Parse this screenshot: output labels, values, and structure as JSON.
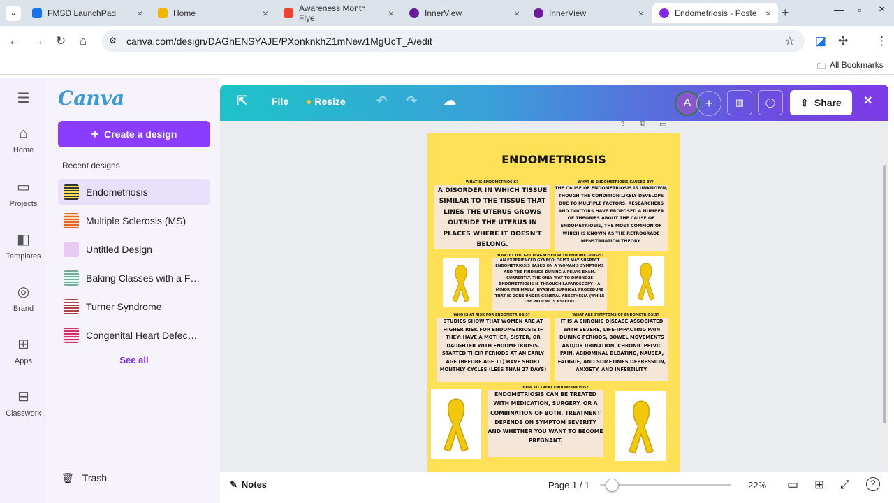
{
  "browser": {
    "tabs": [
      {
        "title": "FMSD LaunchPad",
        "color": "#1a73e8"
      },
      {
        "title": "Home",
        "color": "#f4b400"
      },
      {
        "title": "Awareness Month Flye",
        "color": "#ea4335"
      },
      {
        "title": "InnerView",
        "color": "#6a1b9a"
      },
      {
        "title": "InnerView",
        "color": "#6a1b9a"
      },
      {
        "title": "Endometriosis - Poste",
        "color": "#7d2ae8"
      }
    ],
    "url": "canva.com/design/DAGhENSYAJE/PXonknkhZ1mNew1MgUcT_A/edit",
    "bookmarks_label": "All Bookmarks"
  },
  "rail": [
    {
      "label": "Home",
      "icon": "home-icon",
      "glyph": "⌂"
    },
    {
      "label": "Projects",
      "icon": "folder-icon",
      "glyph": "▭"
    },
    {
      "label": "Templates",
      "icon": "templates-icon",
      "glyph": "◧"
    },
    {
      "label": "Brand",
      "icon": "brand-icon",
      "glyph": "◎"
    },
    {
      "label": "Apps",
      "icon": "apps-icon",
      "glyph": "⊞"
    },
    {
      "label": "Classwork",
      "icon": "classwork-icon",
      "glyph": "⊟"
    }
  ],
  "panel": {
    "logo": "Canva",
    "create": "Create a design",
    "recent_heading": "Recent designs",
    "recent": [
      "Endometriosis",
      "Multiple Sclerosis (MS)",
      "Untitled Design",
      "Baking Classes with a F…",
      "Turner Syndrome",
      "Congenital Heart Defec…"
    ],
    "see_all": "See all",
    "trash": "Trash"
  },
  "toolbar": {
    "file": "File",
    "resize": "Resize",
    "avatar": "A",
    "share": "Share"
  },
  "bottom": {
    "notes": "Notes",
    "page": "Page 1 / 1",
    "zoom": "22%",
    "zoom_fraction": 0.22
  },
  "poster": {
    "title": "Endometriosis",
    "q1": "What is endometriosis?",
    "a1": "A disorder in which tissue similar to the tissue that lines the uterus grows outside the uterus in places where it doesn't belong.",
    "q2": "What is endometriosis caused by?",
    "a2": "The cause of endometriosis is unknown, though the condition likely develops due to multiple factors. Researchers and doctors have proposed a number of theories about the cause of endometriosis, the most common of which is known as the retrograde menstruation theory.",
    "q3": "How do you get diagnosed with endometriosis?",
    "a3": "An experienced gynecologist may suspect endometriosis based on a woman's symptoms and the findings during a pelvic exam. Currently, the only way to diagnose endometriosis is through laparoscopy – a minor minimally invasive surgical procedure that is done under general anesthesia (while the patient is asleep).",
    "q4": "Who is at risk for endometriosis?",
    "a4": "Studies show that women are at higher risk for endometriosis if they: have a mother, sister, or daughter with endometriosis. started their periods at an early age (before age 11) have short monthly cycles (less than 27 days)",
    "q5": "What are symptoms of  endometriosis?",
    "a5": "It is a chronic disease associated with severe, life-impacting pain during periods, bowel movements and/or urination, chronic pelvic pain, abdominal bloating, nausea, fatigue, and sometimes depression, anxiety, and infertility.",
    "q6": "How to treat endometriosis?",
    "a6": "Endometriosis can be treated with medication, surgery, or a combination of both. Treatment depends on symptom severity and whether you want to become pregnant."
  }
}
